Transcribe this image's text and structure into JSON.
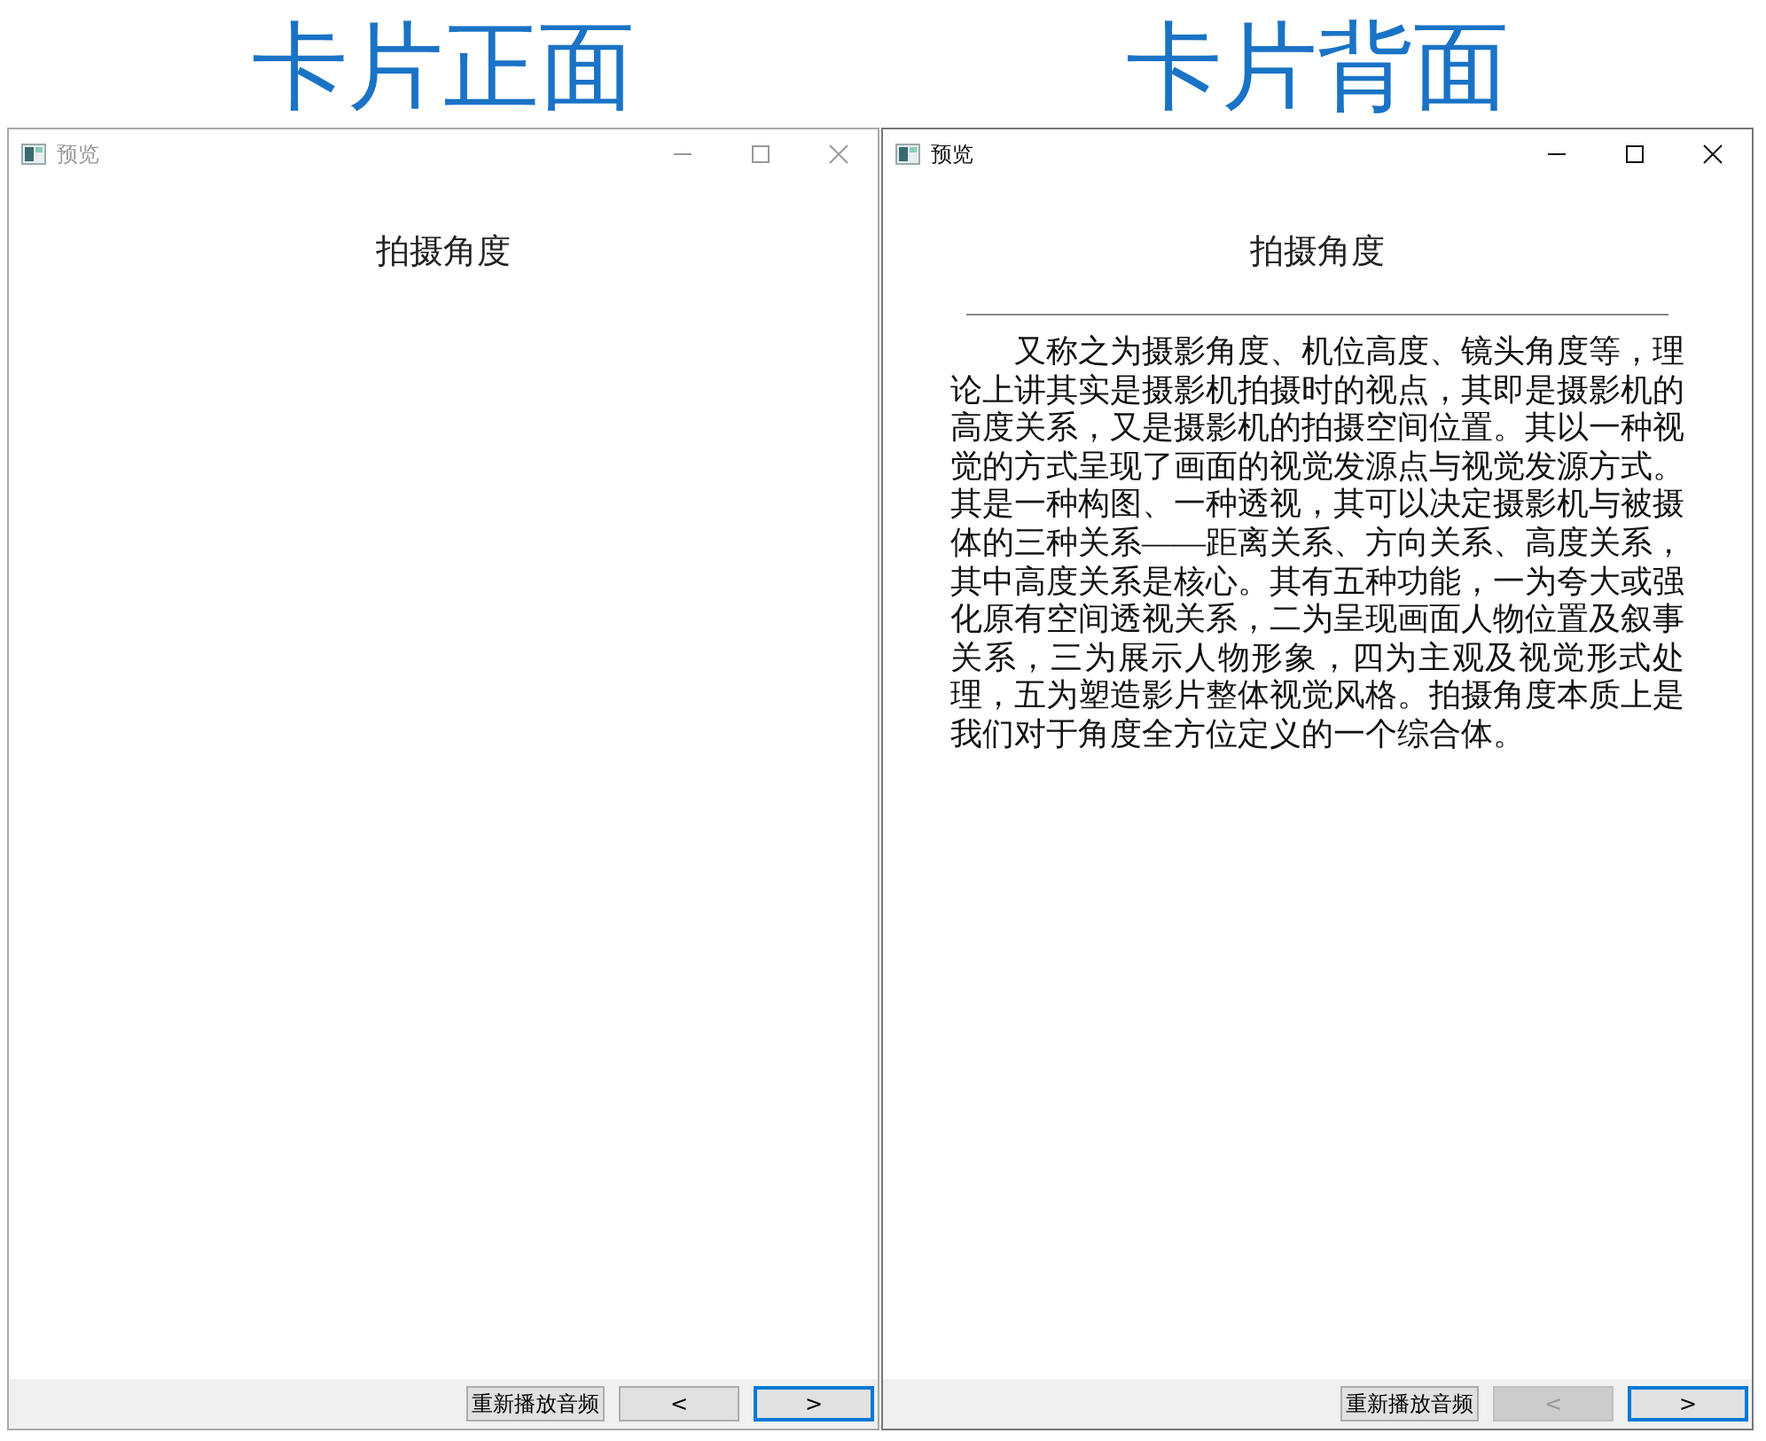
{
  "panels": [
    {
      "caption": "卡片正面",
      "window": {
        "title": "预览",
        "active": false
      },
      "card_title": "拍摄角度",
      "divider": false,
      "buttons": {
        "replay": {
          "label": "重新播放音频"
        },
        "prev": {
          "label": "<",
          "disabled": false
        },
        "next": {
          "label": ">",
          "focused": true
        }
      }
    },
    {
      "caption": "卡片背面",
      "window": {
        "title": "预览",
        "active": true
      },
      "card_title": "拍摄角度",
      "divider": true,
      "body": "又称之为摄影角度、机位高度、镜头角度等，理论上讲其实是摄影机拍摄时的视点，其即是摄影机的高度关系，又是摄影机的拍摄空间位置。其以一种视觉的方式呈现了画面的视觉发源点与视觉发源方式。其是一种构图、一种透视，其可以决定摄影机与被摄体的三种关系——距离关系、方向关系、高度关系，其中高度关系是核心。其有五种功能，一为夸大或强化原有空间透视关系，二为呈现画面人物位置及叙事关系，三为展示人物形象，四为主观及视觉形式处理，五为塑造影片整体视觉风格。拍摄角度本质上是我们对于角度全方位定义的一个综合体。",
      "buttons": {
        "replay": {
          "label": "重新播放音频"
        },
        "prev": {
          "label": "<",
          "disabled": true
        },
        "next": {
          "label": ">",
          "focused": true
        }
      }
    }
  ]
}
